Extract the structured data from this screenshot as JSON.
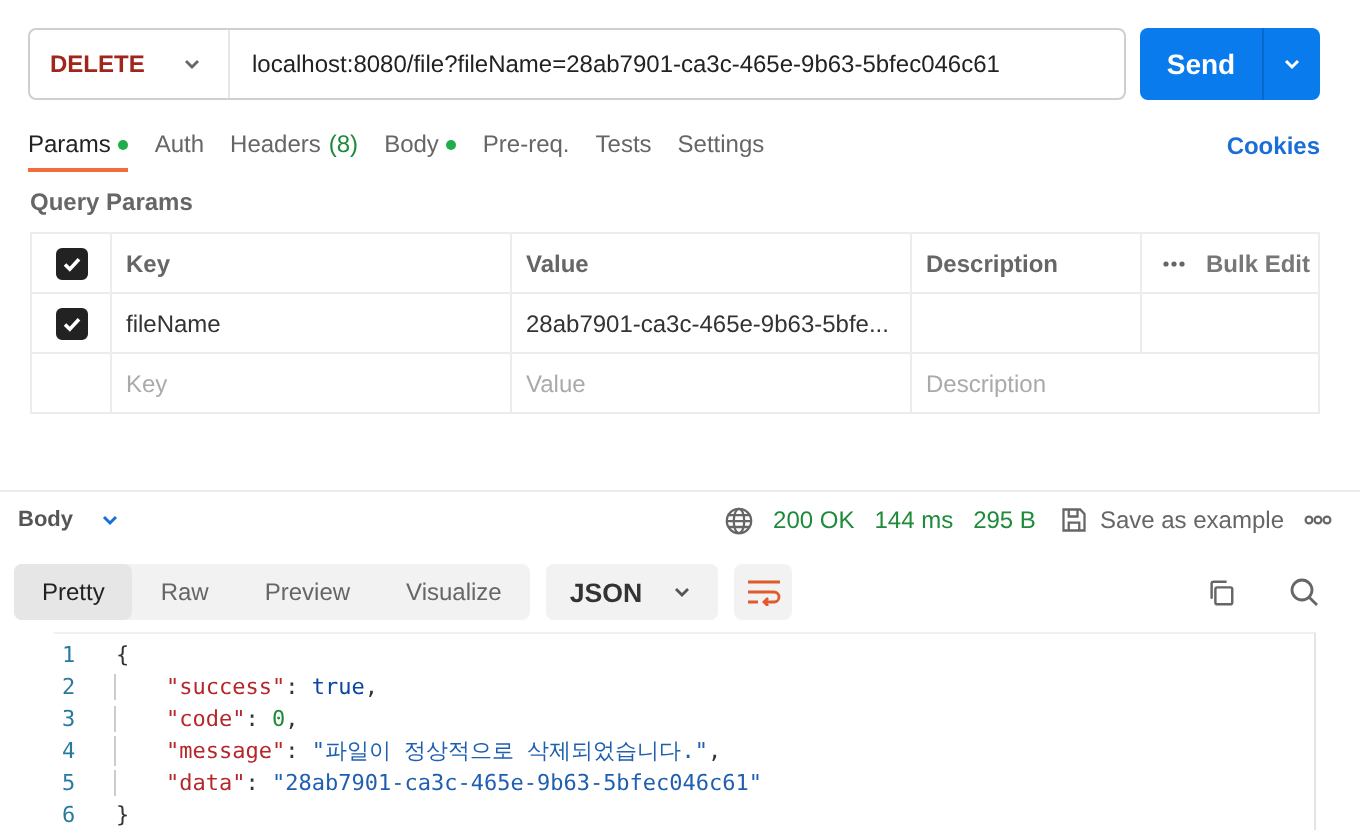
{
  "request": {
    "method": "DELETE",
    "url": "localhost:8080/file?fileName=28ab7901-ca3c-465e-9b63-5bfec046c61",
    "send": "Send"
  },
  "tabs": [
    {
      "label": "Params",
      "selected": true,
      "dot": true
    },
    {
      "label": "Auth",
      "selected": false,
      "dot": false
    },
    {
      "label": "Headers",
      "count": "(8)",
      "selected": false,
      "dot": false
    },
    {
      "label": "Body",
      "selected": false,
      "dot": true
    },
    {
      "label": "Pre-req.",
      "selected": false,
      "dot": false
    },
    {
      "label": "Tests",
      "selected": false,
      "dot": false
    },
    {
      "label": "Settings",
      "selected": false,
      "dot": false
    }
  ],
  "cookies": "Cookies",
  "query_params": {
    "title": "Query Params",
    "header_checked": true,
    "columns": [
      "Key",
      "Value",
      "Description"
    ],
    "bulk_edit": "Bulk Edit",
    "rows": [
      {
        "checked": true,
        "key": "fileName",
        "value": "28ab7901-ca3c-465e-9b63-5bfe..."
      }
    ],
    "new_row": [
      {
        "placeholder": "Key"
      },
      {
        "placeholder": "Value"
      },
      {
        "placeholder": "Description"
      }
    ]
  },
  "response": {
    "label": "Body",
    "status": "200 OK",
    "time": "144 ms",
    "size": "295 B",
    "save": "Save as example",
    "views": [
      {
        "label": "Pretty",
        "selected": true
      },
      {
        "label": "Raw",
        "selected": false
      },
      {
        "label": "Preview",
        "selected": false
      },
      {
        "label": "Visualize",
        "selected": false
      }
    ],
    "format": "JSON",
    "lines": [
      {
        "number": "1",
        "tokens": [
          {
            "kind": "punct",
            "text": "{"
          }
        ]
      },
      {
        "number": "2",
        "tokens": [
          {
            "kind": "key",
            "text": "\"success\""
          },
          {
            "kind": "punct",
            "text": ": "
          },
          {
            "kind": "bool",
            "text": "true"
          },
          {
            "kind": "punct",
            "text": ","
          }
        ]
      },
      {
        "number": "3",
        "tokens": [
          {
            "kind": "key",
            "text": "\"code\""
          },
          {
            "kind": "punct",
            "text": ": "
          },
          {
            "kind": "number",
            "text": "0"
          },
          {
            "kind": "punct",
            "text": ","
          }
        ]
      },
      {
        "number": "4",
        "tokens": [
          {
            "kind": "key",
            "text": "\"message\""
          },
          {
            "kind": "punct",
            "text": ": "
          },
          {
            "kind": "string",
            "text": "\"파일이 정상적으로 삭제되었습니다.\""
          },
          {
            "kind": "punct",
            "text": ","
          }
        ]
      },
      {
        "number": "5",
        "tokens": [
          {
            "kind": "key",
            "text": "\"data\""
          },
          {
            "kind": "punct",
            "text": ": "
          },
          {
            "kind": "string",
            "text": "\"28ab7901-ca3c-465e-9b63-5bfec046c61\""
          }
        ]
      },
      {
        "number": "6",
        "tokens": [
          {
            "kind": "punct",
            "text": "}"
          }
        ]
      }
    ]
  }
}
